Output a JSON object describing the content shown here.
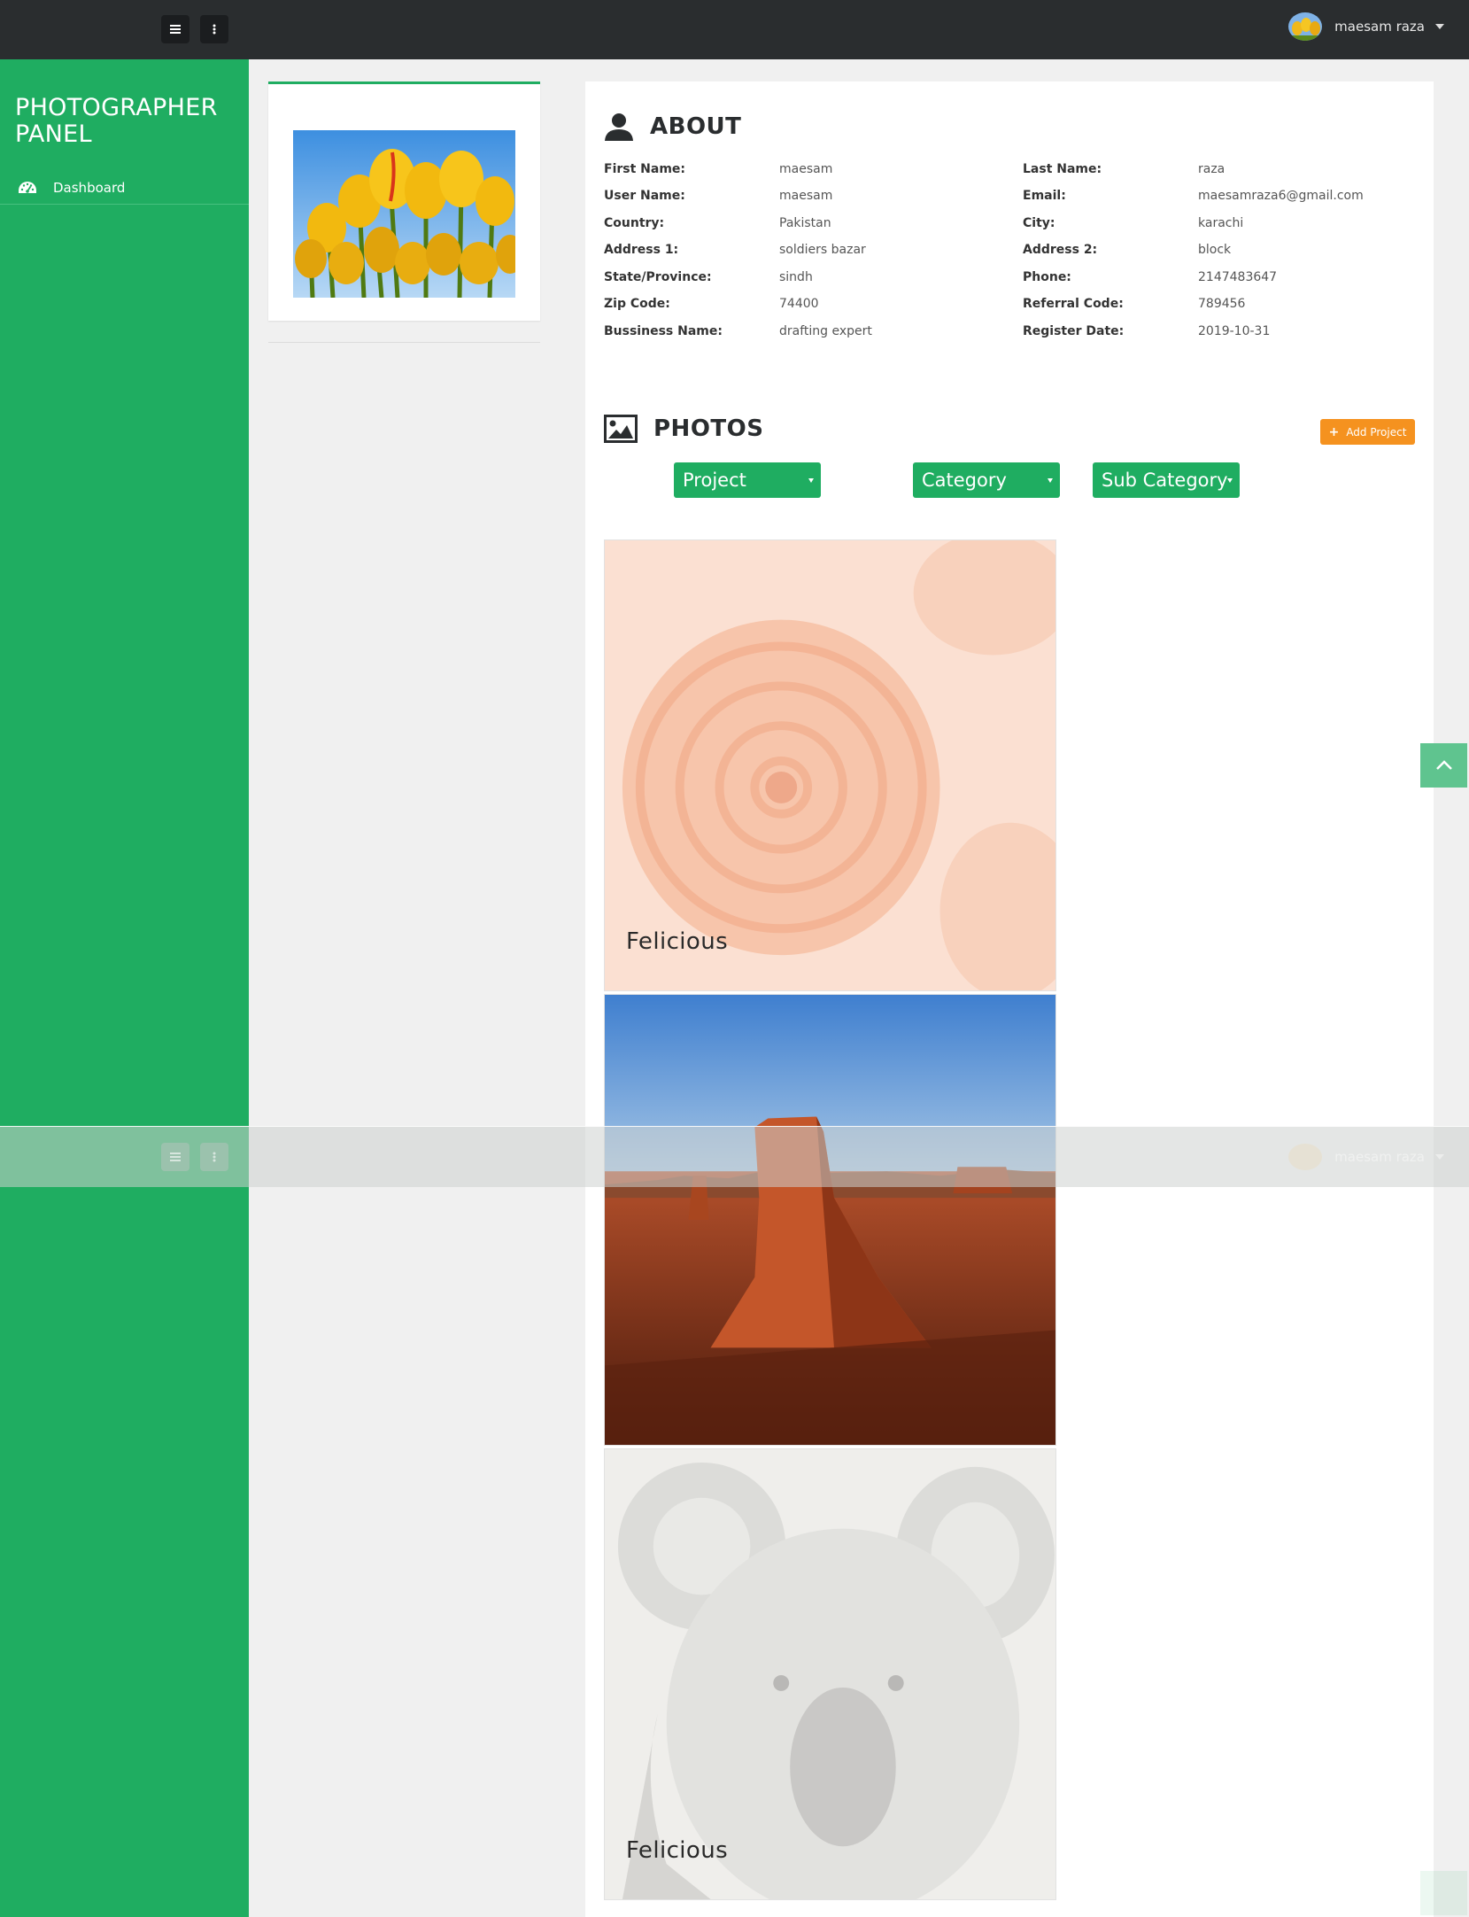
{
  "header": {
    "user_name": "maesam raza"
  },
  "sidebar": {
    "brand": "PHOTOGRAPHER PANEL",
    "items": [
      {
        "label": "Dashboard",
        "icon": "dashboard-icon"
      }
    ]
  },
  "about": {
    "title": "ABOUT",
    "left_fields": [
      {
        "label": "First Name:",
        "value": "maesam"
      },
      {
        "label": "User Name:",
        "value": "maesam"
      },
      {
        "label": "Country:",
        "value": "Pakistan"
      },
      {
        "label": "Address 1:",
        "value": "soldiers bazar"
      },
      {
        "label": "State/Province:",
        "value": "sindh"
      },
      {
        "label": "Zip Code:",
        "value": "74400"
      },
      {
        "label": "Bussiness Name:",
        "value": "drafting expert"
      }
    ],
    "right_fields": [
      {
        "label": "Last Name:",
        "value": "raza"
      },
      {
        "label": "Email:",
        "value": "maesamraza6@gmail.com"
      },
      {
        "label": "City:",
        "value": "karachi"
      },
      {
        "label": "Address 2:",
        "value": "block"
      },
      {
        "label": "Phone:",
        "value": "2147483647"
      },
      {
        "label": "Referral Code:",
        "value": "789456"
      },
      {
        "label": "Register Date:",
        "value": "2019-10-31"
      }
    ]
  },
  "photos": {
    "title": "PHOTOS",
    "add_button": "Add Project",
    "filters": {
      "project": "Project",
      "category": "Category",
      "sub_category": "Sub Category"
    },
    "items": [
      {
        "caption": "Felicious",
        "image": "chrysanthemum"
      },
      {
        "caption": "",
        "image": "desert"
      },
      {
        "caption": "Felicious",
        "image": "koala"
      }
    ]
  },
  "colors": {
    "sidebar": "#1fad61",
    "topbar": "#2a2d2f",
    "accent_orange": "#f5921f"
  }
}
